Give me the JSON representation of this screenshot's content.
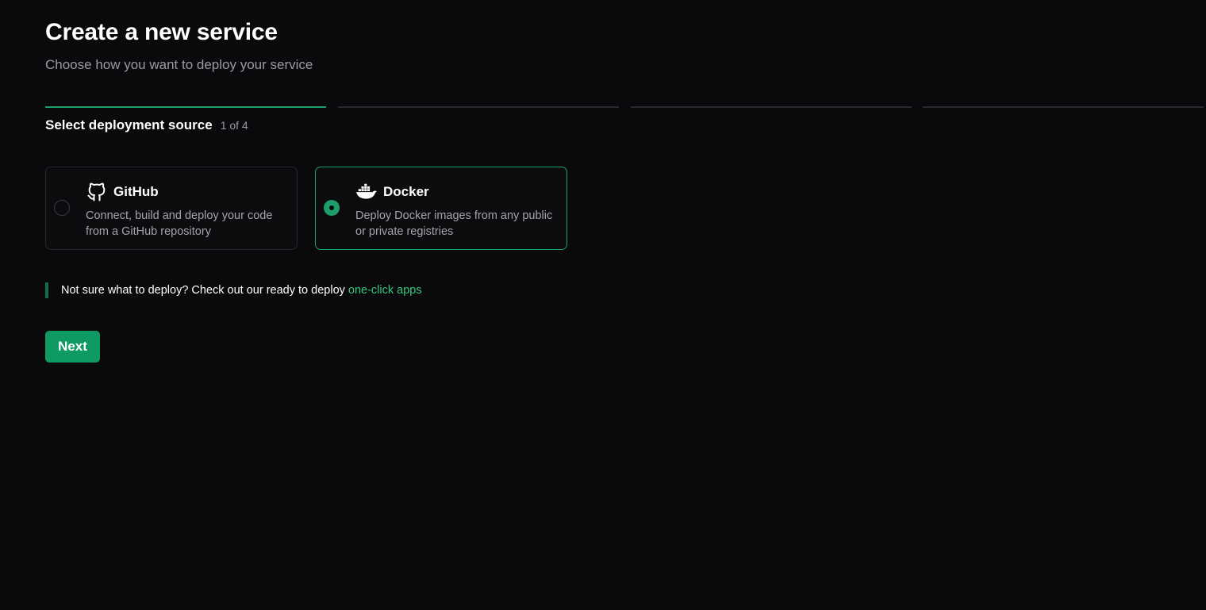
{
  "header": {
    "title": "Create a new service",
    "subtitle": "Choose how you want to deploy your service"
  },
  "stepper": {
    "current_step": 1,
    "total_steps": 4,
    "step_label": "Select deployment source",
    "step_counter": "1 of 4"
  },
  "sources": [
    {
      "name": "GitHub",
      "icon": "github-icon",
      "description": "Connect, build and deploy your code from a GitHub repository",
      "selected": false
    },
    {
      "name": "Docker",
      "icon": "docker-icon",
      "description": "Deploy Docker images from any public or private registries",
      "selected": true
    }
  ],
  "hint": {
    "text": "Not sure what to deploy? Check out our ready to deploy",
    "link_label": "one-click apps"
  },
  "actions": {
    "next_label": "Next"
  },
  "colors": {
    "accent": "#1e9e6a",
    "button": "#0f9a64",
    "link": "#34c77b",
    "background": "#0a0a0c"
  }
}
